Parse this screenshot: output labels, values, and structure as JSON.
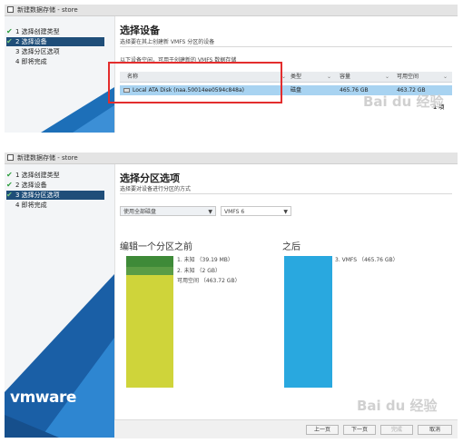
{
  "panel1": {
    "window_title": "新建数据存储 - store",
    "steps": [
      {
        "label": "1 选择创建类型",
        "done": true
      },
      {
        "label": "2 选择设备",
        "done": true
      },
      {
        "label": "3 选择分区选项",
        "done": false
      },
      {
        "label": "4 即将完成",
        "done": false
      }
    ],
    "active_step": 1,
    "title": "选择设备",
    "subtitle": "选择要在其上创建新 VMFS 分区的设备",
    "list_caption": "以下设备空闲，可用于创建新的 VMFS 数据存储",
    "columns": [
      "名称",
      "类型",
      "容量",
      "可用空间"
    ],
    "row": {
      "name": "Local ATA Disk (naa.50014ee0594c848a)",
      "type": "磁盘",
      "capacity": "465.76 GB",
      "free": "463.72 GB"
    },
    "count": "1 项",
    "highlight_color": "#e32d2d"
  },
  "panel2": {
    "window_title": "新建数据存储 - store",
    "steps": [
      {
        "label": "1 选择创建类型",
        "done": true
      },
      {
        "label": "2 选择设备",
        "done": true
      },
      {
        "label": "3 选择分区选项",
        "done": true
      },
      {
        "label": "4 即将完成",
        "done": false
      }
    ],
    "active_step": 2,
    "title": "选择分区选项",
    "subtitle": "选择要对设备进行分区的方式",
    "partition_select": "使用全部磁盘",
    "vmfs_select": "VMFS 6",
    "before_label": "编辑一个分区之前",
    "after_label": "之后",
    "before_legend": [
      "1. 未知 （39.19 MB）",
      "2. 未知 （2 GB）",
      "可用空间 （463.72 GB）"
    ],
    "after_legend": [
      "3. VMFS （465.76 GB）"
    ],
    "before_segments": [
      {
        "fraction": 0.08,
        "color": "#3e8a38"
      },
      {
        "fraction": 0.065,
        "color": "#5a9c46"
      },
      {
        "fraction": 0.855,
        "color": "#cfd43a"
      }
    ],
    "after_color": "#29a8df",
    "brand": "vmware",
    "buttons": {
      "back": "上一页",
      "next": "下一页",
      "finish": "完成",
      "cancel": "取消"
    }
  },
  "watermark": "Bai du 经验"
}
